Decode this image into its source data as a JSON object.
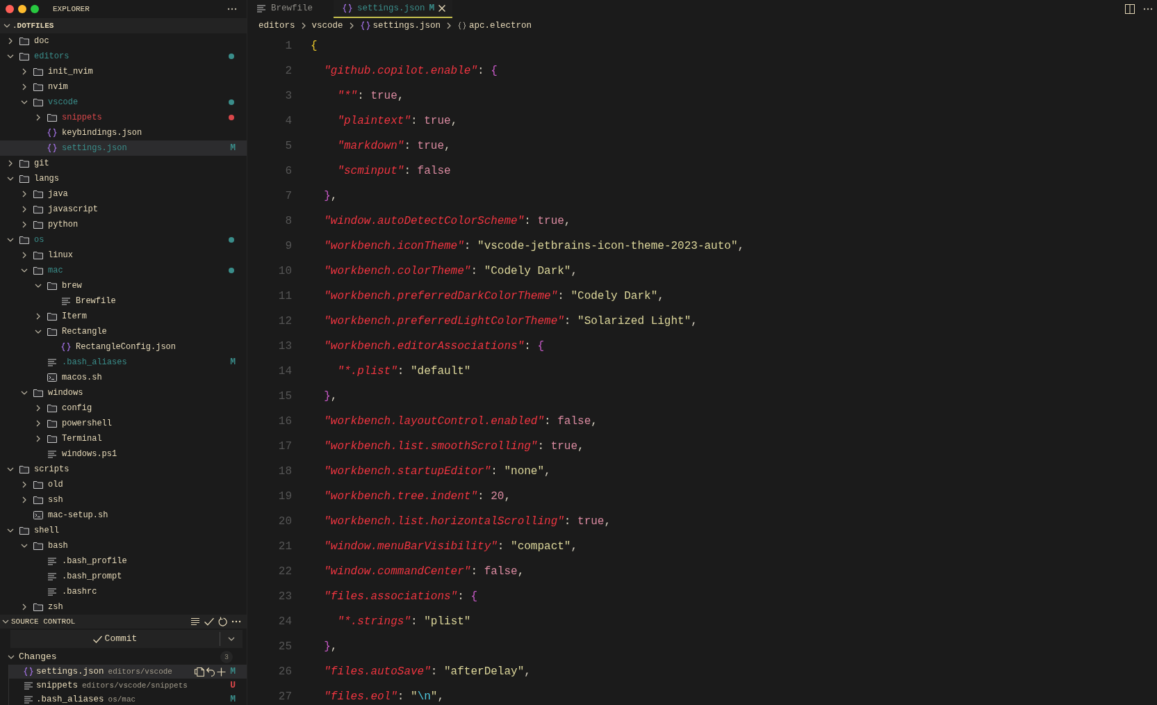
{
  "explorer": {
    "title": "EXPLORER",
    "root": {
      "label": ".DOTFILES",
      "expanded": true
    },
    "tree": [
      {
        "label": "doc",
        "kind": "folder",
        "expanded": false,
        "selected": false
      },
      {
        "label": "editors",
        "kind": "folder",
        "expanded": true,
        "selected": false,
        "color": "#3a8d8a",
        "children": [
          {
            "label": "init_nvim",
            "kind": "folder",
            "expanded": false,
            "selected": false
          },
          {
            "label": "nvim",
            "kind": "folder",
            "expanded": false,
            "selected": false
          },
          {
            "label": "vscode",
            "kind": "folder",
            "expanded": true,
            "selected": false,
            "color": "#3a8d8a",
            "children": [
              {
                "label": "snippets",
                "kind": "folder",
                "expanded": false,
                "selected": false,
                "color": "#d9474a"
              },
              {
                "label": "keybindings.json",
                "kind": "json",
                "selected": false
              },
              {
                "label": "settings.json",
                "kind": "json",
                "selected": true,
                "color": "#3a8d8a",
                "badge": "M"
              }
            ]
          }
        ]
      },
      {
        "label": "git",
        "kind": "folder",
        "expanded": false,
        "selected": false
      },
      {
        "label": "langs",
        "kind": "folder",
        "expanded": true,
        "selected": false,
        "children": [
          {
            "label": "java",
            "kind": "folder",
            "expanded": false,
            "selected": false
          },
          {
            "label": "javascript",
            "kind": "folder",
            "expanded": false,
            "selected": false
          },
          {
            "label": "python",
            "kind": "folder",
            "expanded": false,
            "selected": false
          }
        ]
      },
      {
        "label": "os",
        "kind": "folder",
        "expanded": true,
        "selected": false,
        "color": "#3a8d8a",
        "children": [
          {
            "label": "linux",
            "kind": "folder",
            "expanded": false,
            "selected": false
          },
          {
            "label": "mac",
            "kind": "folder",
            "expanded": true,
            "selected": false,
            "color": "#3a8d8a",
            "children": [
              {
                "label": "brew",
                "kind": "folder",
                "expanded": true,
                "selected": false,
                "children": [
                  {
                    "label": "Brewfile",
                    "kind": "text",
                    "selected": false
                  }
                ]
              },
              {
                "label": "Iterm",
                "kind": "folder",
                "expanded": false,
                "selected": false
              },
              {
                "label": "Rectangle",
                "kind": "folder",
                "expanded": true,
                "selected": false,
                "children": [
                  {
                    "label": "RectangleConfig.json",
                    "kind": "json",
                    "selected": false
                  }
                ]
              },
              {
                "label": ".bash_aliases",
                "kind": "text",
                "selected": false,
                "color": "#3a8d8a",
                "badge": "M"
              },
              {
                "label": "macos.sh",
                "kind": "shell",
                "selected": false
              }
            ]
          },
          {
            "label": "windows",
            "kind": "folder",
            "expanded": true,
            "selected": false,
            "children": [
              {
                "label": "config",
                "kind": "folder",
                "expanded": false,
                "selected": false
              },
              {
                "label": "powershell",
                "kind": "folder",
                "expanded": false,
                "selected": false
              },
              {
                "label": "Terminal",
                "kind": "folder",
                "expanded": false,
                "selected": false
              },
              {
                "label": "windows.ps1",
                "kind": "text",
                "selected": false
              }
            ]
          }
        ]
      },
      {
        "label": "scripts",
        "kind": "folder",
        "expanded": true,
        "selected": false,
        "children": [
          {
            "label": "old",
            "kind": "folder",
            "expanded": false,
            "selected": false
          },
          {
            "label": "ssh",
            "kind": "folder",
            "expanded": false,
            "selected": false
          },
          {
            "label": "mac-setup.sh",
            "kind": "shell",
            "selected": false
          }
        ]
      },
      {
        "label": "shell",
        "kind": "folder",
        "expanded": true,
        "selected": false,
        "children": [
          {
            "label": "bash",
            "kind": "folder",
            "expanded": true,
            "selected": false,
            "children": [
              {
                "label": ".bash_profile",
                "kind": "text",
                "selected": false
              },
              {
                "label": ".bash_prompt",
                "kind": "text",
                "selected": false
              },
              {
                "label": ".bashrc",
                "kind": "text",
                "selected": false
              }
            ]
          },
          {
            "label": "zsh",
            "kind": "folder",
            "expanded": false,
            "selected": false
          }
        ]
      }
    ]
  },
  "source_control": {
    "title": "SOURCE CONTROL",
    "commit_label": "Commit",
    "changes": {
      "label": "Changes",
      "expanded": true,
      "count": "3",
      "items": [
        {
          "name": "settings.json",
          "path": "editors/vscode",
          "kind": "json",
          "color": "#3a8d8a",
          "badge": "M",
          "selected": true
        },
        {
          "name": "snippets",
          "path": "editors/vscode/snippets",
          "kind": "text",
          "color": "#d9474a",
          "badge": "U",
          "selected": false
        },
        {
          "name": ".bash_aliases",
          "path": "os/mac",
          "kind": "text",
          "color": "#3a8d8a",
          "badge": "M",
          "selected": false
        }
      ]
    }
  },
  "editor": {
    "tabs": [
      {
        "label": "Brewfile",
        "kind": "text",
        "selected": false
      },
      {
        "label": "settings.json",
        "kind": "json",
        "selected": true,
        "color": "#3a8d8a",
        "badge": "M"
      }
    ],
    "breadcrumbs": [
      {
        "label": "editors"
      },
      {
        "label": "vscode"
      },
      {
        "label": "settings.json",
        "kind": "json"
      },
      {
        "label": "apc.electron",
        "kind": "object"
      }
    ],
    "lines": [
      {
        "number": "1",
        "tokens": [
          {
            "kind": "open",
            "text": "{"
          }
        ]
      },
      {
        "number": "2",
        "tokens": [
          {
            "kind": "key",
            "text": "\"github.copilot.enable\""
          },
          {
            "kind": "punct",
            "text": ": "
          },
          {
            "kind": "open",
            "text": "{"
          }
        ]
      },
      {
        "number": "3",
        "tokens": [
          {
            "kind": "key",
            "text": "\"*\""
          },
          {
            "kind": "punct",
            "text": ": "
          },
          {
            "kind": "bool",
            "text": "true"
          },
          {
            "kind": "punct",
            "text": ","
          }
        ]
      },
      {
        "number": "4",
        "tokens": [
          {
            "kind": "key",
            "text": "\"plaintext\""
          },
          {
            "kind": "punct",
            "text": ": "
          },
          {
            "kind": "bool",
            "text": "true"
          },
          {
            "kind": "punct",
            "text": ","
          }
        ]
      },
      {
        "number": "5",
        "tokens": [
          {
            "kind": "key",
            "text": "\"markdown\""
          },
          {
            "kind": "punct",
            "text": ": "
          },
          {
            "kind": "bool",
            "text": "true"
          },
          {
            "kind": "punct",
            "text": ","
          }
        ]
      },
      {
        "number": "6",
        "tokens": [
          {
            "kind": "key",
            "text": "\"scminput\""
          },
          {
            "kind": "punct",
            "text": ": "
          },
          {
            "kind": "bool",
            "text": "false"
          }
        ]
      },
      {
        "number": "7",
        "tokens": [
          {
            "kind": "close",
            "text": "}"
          },
          {
            "kind": "punct",
            "text": ","
          }
        ]
      },
      {
        "number": "8",
        "tokens": [
          {
            "kind": "key",
            "text": "\"window.autoDetectColorScheme\""
          },
          {
            "kind": "punct",
            "text": ": "
          },
          {
            "kind": "bool",
            "text": "true"
          },
          {
            "kind": "punct",
            "text": ","
          }
        ]
      },
      {
        "number": "9",
        "tokens": [
          {
            "kind": "key",
            "text": "\"workbench.iconTheme\""
          },
          {
            "kind": "punct",
            "text": ": "
          },
          {
            "kind": "string",
            "text": "\"vscode-jetbrains-icon-theme-2023-auto\""
          },
          {
            "kind": "punct",
            "text": ","
          }
        ]
      },
      {
        "number": "10",
        "tokens": [
          {
            "kind": "key",
            "text": "\"workbench.colorTheme\""
          },
          {
            "kind": "punct",
            "text": ": "
          },
          {
            "kind": "string",
            "text": "\"Codely Dark\""
          },
          {
            "kind": "punct",
            "text": ","
          }
        ]
      },
      {
        "number": "11",
        "tokens": [
          {
            "kind": "key",
            "text": "\"workbench.preferredDarkColorTheme\""
          },
          {
            "kind": "punct",
            "text": ": "
          },
          {
            "kind": "string",
            "text": "\"Codely Dark\""
          },
          {
            "kind": "punct",
            "text": ","
          }
        ]
      },
      {
        "number": "12",
        "tokens": [
          {
            "kind": "key",
            "text": "\"workbench.preferredLightColorTheme\""
          },
          {
            "kind": "punct",
            "text": ": "
          },
          {
            "kind": "string",
            "text": "\"Solarized Light\""
          },
          {
            "kind": "punct",
            "text": ","
          }
        ]
      },
      {
        "number": "13",
        "tokens": [
          {
            "kind": "key",
            "text": "\"workbench.editorAssociations\""
          },
          {
            "kind": "punct",
            "text": ": "
          },
          {
            "kind": "open",
            "text": "{"
          }
        ]
      },
      {
        "number": "14",
        "tokens": [
          {
            "kind": "key",
            "text": "\"*.plist\""
          },
          {
            "kind": "punct",
            "text": ": "
          },
          {
            "kind": "string",
            "text": "\"default\""
          }
        ]
      },
      {
        "number": "15",
        "tokens": [
          {
            "kind": "close",
            "text": "}"
          },
          {
            "kind": "punct",
            "text": ","
          }
        ]
      },
      {
        "number": "16",
        "tokens": [
          {
            "kind": "key",
            "text": "\"workbench.layoutControl.enabled\""
          },
          {
            "kind": "punct",
            "text": ": "
          },
          {
            "kind": "bool",
            "text": "false"
          },
          {
            "kind": "punct",
            "text": ","
          }
        ]
      },
      {
        "number": "17",
        "tokens": [
          {
            "kind": "key",
            "text": "\"workbench.list.smoothScrolling\""
          },
          {
            "kind": "punct",
            "text": ": "
          },
          {
            "kind": "bool",
            "text": "true"
          },
          {
            "kind": "punct",
            "text": ","
          }
        ]
      },
      {
        "number": "18",
        "tokens": [
          {
            "kind": "key",
            "text": "\"workbench.startupEditor\""
          },
          {
            "kind": "punct",
            "text": ": "
          },
          {
            "kind": "string",
            "text": "\"none\""
          },
          {
            "kind": "punct",
            "text": ","
          }
        ]
      },
      {
        "number": "19",
        "tokens": [
          {
            "kind": "key",
            "text": "\"workbench.tree.indent\""
          },
          {
            "kind": "punct",
            "text": ": "
          },
          {
            "kind": "number",
            "text": "20"
          },
          {
            "kind": "punct",
            "text": ","
          }
        ]
      },
      {
        "number": "20",
        "tokens": [
          {
            "kind": "key",
            "text": "\"workbench.list.horizontalScrolling\""
          },
          {
            "kind": "punct",
            "text": ": "
          },
          {
            "kind": "bool",
            "text": "true"
          },
          {
            "kind": "punct",
            "text": ","
          }
        ]
      },
      {
        "number": "21",
        "tokens": [
          {
            "kind": "key",
            "text": "\"window.menuBarVisibility\""
          },
          {
            "kind": "punct",
            "text": ": "
          },
          {
            "kind": "string",
            "text": "\"compact\""
          },
          {
            "kind": "punct",
            "text": ","
          }
        ]
      },
      {
        "number": "22",
        "tokens": [
          {
            "kind": "key",
            "text": "\"window.commandCenter\""
          },
          {
            "kind": "punct",
            "text": ": "
          },
          {
            "kind": "bool",
            "text": "false"
          },
          {
            "kind": "punct",
            "text": ","
          }
        ]
      },
      {
        "number": "23",
        "tokens": [
          {
            "kind": "key",
            "text": "\"files.associations\""
          },
          {
            "kind": "punct",
            "text": ": "
          },
          {
            "kind": "open",
            "text": "{"
          }
        ]
      },
      {
        "number": "24",
        "tokens": [
          {
            "kind": "key",
            "text": "\"*.strings\""
          },
          {
            "kind": "punct",
            "text": ": "
          },
          {
            "kind": "string",
            "text": "\"plist\""
          }
        ]
      },
      {
        "number": "25",
        "tokens": [
          {
            "kind": "close",
            "text": "}"
          },
          {
            "kind": "punct",
            "text": ","
          }
        ]
      },
      {
        "number": "26",
        "tokens": [
          {
            "kind": "key",
            "text": "\"files.autoSave\""
          },
          {
            "kind": "punct",
            "text": ": "
          },
          {
            "kind": "string",
            "text": "\"afterDelay\""
          },
          {
            "kind": "punct",
            "text": ","
          }
        ]
      },
      {
        "number": "27",
        "tokens": [
          {
            "kind": "key",
            "text": "\"files.eol\""
          },
          {
            "kind": "punct",
            "text": ": "
          },
          {
            "kind": "string",
            "text": "\""
          },
          {
            "kind": "escape",
            "text": "\\n"
          },
          {
            "kind": "string",
            "text": "\""
          },
          {
            "kind": "punct",
            "text": ","
          }
        ]
      }
    ]
  }
}
